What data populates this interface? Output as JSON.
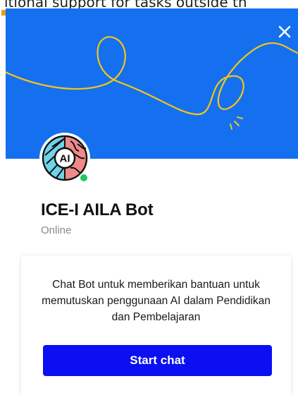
{
  "background_page": {
    "text": "itional support for tasks outside th"
  },
  "widget": {
    "banner": {
      "color": "#1570ef",
      "doodle_color": "#f5c518",
      "close_icon": "close-icon"
    },
    "bot": {
      "avatar_text": "AI",
      "avatar_icon": "brain-ai-icon",
      "name": "ICE-I AILA Bot",
      "status": "Online",
      "status_color": "#22c55e"
    },
    "card": {
      "description": "Chat Bot untuk memberikan bantuan untuk memutuskan penggunaan AI dalam Pendidikan dan Pembelajaran",
      "button_label": "Start chat",
      "button_color": "#0b0ff2"
    }
  }
}
